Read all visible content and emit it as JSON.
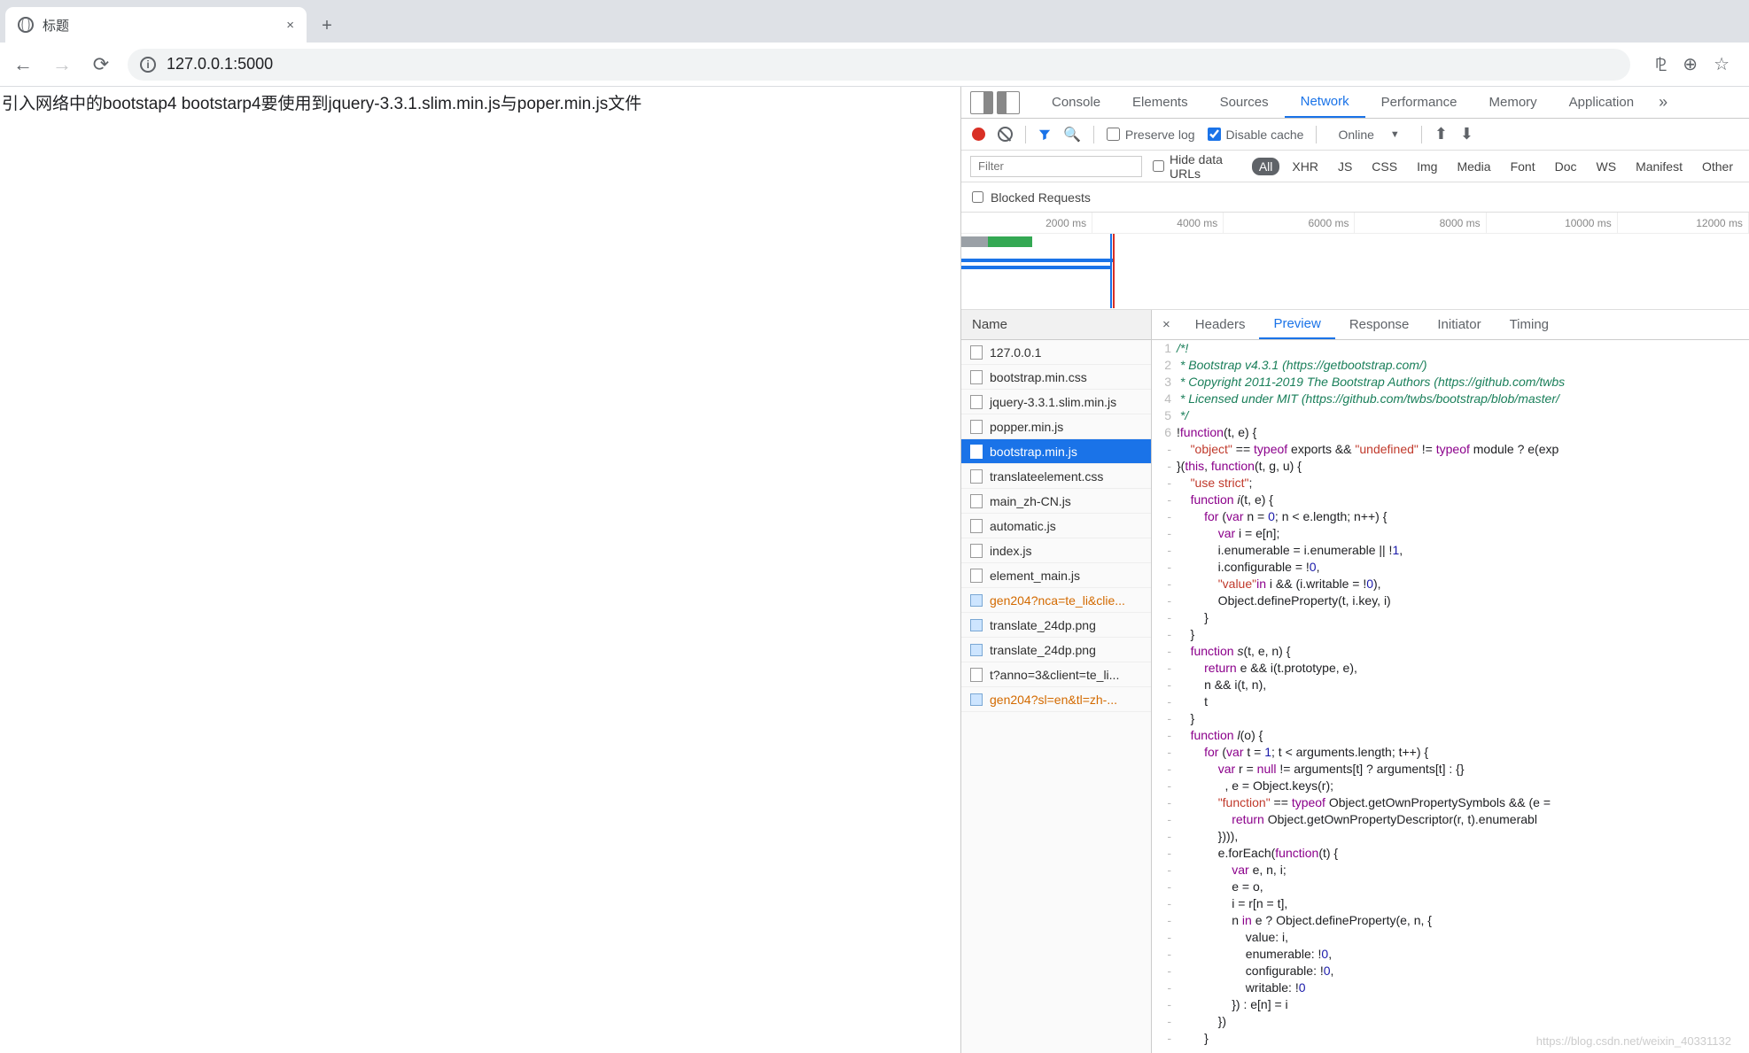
{
  "browser": {
    "tab_title": "标题",
    "url": "127.0.0.1:5000",
    "close_glyph": "×",
    "new_tab_glyph": "+"
  },
  "page": {
    "body_text": "引入网络中的bootstap4 bootstarp4要使用到jquery-3.3.1.slim.min.js与poper.min.js文件"
  },
  "devtools": {
    "tabs": [
      "Console",
      "Elements",
      "Sources",
      "Network",
      "Performance",
      "Memory",
      "Application"
    ],
    "active_tab": "Network",
    "more_glyph": "»",
    "toolbar": {
      "preserve_log_label": "Preserve log",
      "disable_cache_label": "Disable cache",
      "disable_cache_checked": true,
      "throttling_value": "Online",
      "throttling_caret": "▼",
      "upload_glyph": "⬆",
      "download_glyph": "⬇"
    },
    "filterbar": {
      "placeholder": "Filter",
      "hide_data_urls_label": "Hide data URLs",
      "types": [
        "All",
        "XHR",
        "JS",
        "CSS",
        "Img",
        "Media",
        "Font",
        "Doc",
        "WS",
        "Manifest",
        "Other"
      ],
      "active_type": "All",
      "blocked_label": "Blocked Requests"
    },
    "timeline_ticks": [
      "2000 ms",
      "4000 ms",
      "6000 ms",
      "8000 ms",
      "10000 ms",
      "12000 ms"
    ],
    "name_header": "Name",
    "requests": [
      {
        "name": "127.0.0.1",
        "type": "doc"
      },
      {
        "name": "bootstrap.min.css",
        "type": "file"
      },
      {
        "name": "jquery-3.3.1.slim.min.js",
        "type": "file"
      },
      {
        "name": "popper.min.js",
        "type": "file"
      },
      {
        "name": "bootstrap.min.js",
        "type": "file",
        "selected": true
      },
      {
        "name": "translateelement.css",
        "type": "file"
      },
      {
        "name": "main_zh-CN.js",
        "type": "file"
      },
      {
        "name": "automatic.js",
        "type": "file"
      },
      {
        "name": "index.js",
        "type": "file"
      },
      {
        "name": "element_main.js",
        "type": "file"
      },
      {
        "name": "gen204?nca=te_li&clie...",
        "type": "img",
        "orange": true
      },
      {
        "name": "translate_24dp.png",
        "type": "img"
      },
      {
        "name": "translate_24dp.png",
        "type": "img"
      },
      {
        "name": "t?anno=3&client=te_li...",
        "type": "file"
      },
      {
        "name": "gen204?sl=en&tl=zh-...",
        "type": "img",
        "orange": true
      }
    ],
    "detail_tabs": [
      "Headers",
      "Preview",
      "Response",
      "Initiator",
      "Timing"
    ],
    "active_detail_tab": "Preview",
    "code": [
      {
        "n": "1",
        "body": [
          {
            "t": "/*!",
            "c": "cm"
          }
        ]
      },
      {
        "n": "2",
        "body": [
          {
            "t": " * Bootstrap v4.3.1 (https://getbootstrap.com/)",
            "c": "cm"
          }
        ]
      },
      {
        "n": "3",
        "body": [
          {
            "t": " * Copyright 2011-2019 The Bootstrap Authors (https://github.com/twbs",
            "c": "cm"
          }
        ]
      },
      {
        "n": "4",
        "body": [
          {
            "t": " * Licensed under MIT (https://github.com/twbs/bootstrap/blob/master/",
            "c": "cm"
          }
        ]
      },
      {
        "n": "5",
        "body": [
          {
            "t": " */",
            "c": "cm"
          }
        ]
      },
      {
        "n": "6",
        "body": [
          {
            "t": "!"
          },
          {
            "t": "function",
            "c": "kw"
          },
          {
            "t": "(t, e) {"
          }
        ]
      },
      {
        "n": "-",
        "body": [
          {
            "t": "    "
          },
          {
            "t": "\"object\"",
            "c": "str"
          },
          {
            "t": " == "
          },
          {
            "t": "typeof",
            "c": "kw"
          },
          {
            "t": " exports && "
          },
          {
            "t": "\"undefined\"",
            "c": "str"
          },
          {
            "t": " != "
          },
          {
            "t": "typeof",
            "c": "kw"
          },
          {
            "t": " module ? e(exp"
          }
        ]
      },
      {
        "n": "-",
        "body": [
          {
            "t": "}("
          },
          {
            "t": "this",
            "c": "kw"
          },
          {
            "t": ", "
          },
          {
            "t": "function",
            "c": "kw"
          },
          {
            "t": "(t, g, u) {"
          }
        ]
      },
      {
        "n": "-",
        "body": [
          {
            "t": "    "
          },
          {
            "t": "\"use strict\"",
            "c": "str"
          },
          {
            "t": ";"
          }
        ]
      },
      {
        "n": "-",
        "body": [
          {
            "t": "    "
          },
          {
            "t": "function",
            "c": "kw"
          },
          {
            "t": " "
          },
          {
            "t": "i",
            "c": "fn"
          },
          {
            "t": "(t, e) {"
          }
        ]
      },
      {
        "n": "-",
        "body": [
          {
            "t": "        "
          },
          {
            "t": "for",
            "c": "kw"
          },
          {
            "t": " ("
          },
          {
            "t": "var",
            "c": "kw"
          },
          {
            "t": " n = "
          },
          {
            "t": "0",
            "c": "num"
          },
          {
            "t": "; n < e.length; n++) {"
          }
        ]
      },
      {
        "n": "-",
        "body": [
          {
            "t": "            "
          },
          {
            "t": "var",
            "c": "kw"
          },
          {
            "t": " i = e[n];"
          }
        ]
      },
      {
        "n": "-",
        "body": [
          {
            "t": "            i.enumerable = i.enumerable || !"
          },
          {
            "t": "1",
            "c": "num"
          },
          {
            "t": ","
          }
        ]
      },
      {
        "n": "-",
        "body": [
          {
            "t": "            i.configurable = !"
          },
          {
            "t": "0",
            "c": "num"
          },
          {
            "t": ","
          }
        ]
      },
      {
        "n": "-",
        "body": [
          {
            "t": "            "
          },
          {
            "t": "\"value\"",
            "c": "str"
          },
          {
            "t": "in",
            "c": "kw"
          },
          {
            "t": " i && (i.writable = !"
          },
          {
            "t": "0",
            "c": "num"
          },
          {
            "t": "),"
          }
        ]
      },
      {
        "n": "-",
        "body": [
          {
            "t": "            Object.defineProperty(t, i.key, i)"
          }
        ]
      },
      {
        "n": "-",
        "body": [
          {
            "t": "        }"
          }
        ]
      },
      {
        "n": "-",
        "body": [
          {
            "t": "    }"
          }
        ]
      },
      {
        "n": "-",
        "body": [
          {
            "t": "    "
          },
          {
            "t": "function",
            "c": "kw"
          },
          {
            "t": " "
          },
          {
            "t": "s",
            "c": "fn"
          },
          {
            "t": "(t, e, n) {"
          }
        ]
      },
      {
        "n": "-",
        "body": [
          {
            "t": "        "
          },
          {
            "t": "return",
            "c": "kw"
          },
          {
            "t": " e && i(t.prototype, e),"
          }
        ]
      },
      {
        "n": "-",
        "body": [
          {
            "t": "        n && i(t, n),"
          }
        ]
      },
      {
        "n": "-",
        "body": [
          {
            "t": "        t"
          }
        ]
      },
      {
        "n": "-",
        "body": [
          {
            "t": "    }"
          }
        ]
      },
      {
        "n": "-",
        "body": [
          {
            "t": "    "
          },
          {
            "t": "function",
            "c": "kw"
          },
          {
            "t": " "
          },
          {
            "t": "l",
            "c": "fn"
          },
          {
            "t": "(o) {"
          }
        ]
      },
      {
        "n": "-",
        "body": [
          {
            "t": "        "
          },
          {
            "t": "for",
            "c": "kw"
          },
          {
            "t": " ("
          },
          {
            "t": "var",
            "c": "kw"
          },
          {
            "t": " t = "
          },
          {
            "t": "1",
            "c": "num"
          },
          {
            "t": "; t < arguments.length; t++) {"
          }
        ]
      },
      {
        "n": "-",
        "body": [
          {
            "t": "            "
          },
          {
            "t": "var",
            "c": "kw"
          },
          {
            "t": " r = "
          },
          {
            "t": "null",
            "c": "kw"
          },
          {
            "t": " != arguments[t] ? arguments[t] : {}"
          }
        ]
      },
      {
        "n": "-",
        "body": [
          {
            "t": "              , e = Object.keys(r);"
          }
        ]
      },
      {
        "n": "-",
        "body": [
          {
            "t": "            "
          },
          {
            "t": "\"function\"",
            "c": "str"
          },
          {
            "t": " == "
          },
          {
            "t": "typeof",
            "c": "kw"
          },
          {
            "t": " Object.getOwnPropertySymbols && (e ="
          }
        ]
      },
      {
        "n": "-",
        "body": [
          {
            "t": "                "
          },
          {
            "t": "return",
            "c": "kw"
          },
          {
            "t": " Object.getOwnPropertyDescriptor(r, t).enumerabl"
          }
        ]
      },
      {
        "n": "-",
        "body": [
          {
            "t": "            }))),"
          }
        ]
      },
      {
        "n": "-",
        "body": [
          {
            "t": "            e.forEach("
          },
          {
            "t": "function",
            "c": "kw"
          },
          {
            "t": "(t) {"
          }
        ]
      },
      {
        "n": "-",
        "body": [
          {
            "t": "                "
          },
          {
            "t": "var",
            "c": "kw"
          },
          {
            "t": " e, n, i;"
          }
        ]
      },
      {
        "n": "-",
        "body": [
          {
            "t": "                e = o,"
          }
        ]
      },
      {
        "n": "-",
        "body": [
          {
            "t": "                i = r[n = t],"
          }
        ]
      },
      {
        "n": "-",
        "body": [
          {
            "t": "                n "
          },
          {
            "t": "in",
            "c": "kw"
          },
          {
            "t": " e ? Object.defineProperty(e, n, {"
          }
        ]
      },
      {
        "n": "-",
        "body": [
          {
            "t": "                    value: i,"
          }
        ]
      },
      {
        "n": "-",
        "body": [
          {
            "t": "                    enumerable: !"
          },
          {
            "t": "0",
            "c": "num"
          },
          {
            "t": ","
          }
        ]
      },
      {
        "n": "-",
        "body": [
          {
            "t": "                    configurable: !"
          },
          {
            "t": "0",
            "c": "num"
          },
          {
            "t": ","
          }
        ]
      },
      {
        "n": "-",
        "body": [
          {
            "t": "                    writable: !"
          },
          {
            "t": "0",
            "c": "num"
          }
        ]
      },
      {
        "n": "-",
        "body": [
          {
            "t": "                }) : e[n] = i"
          }
        ]
      },
      {
        "n": "-",
        "body": [
          {
            "t": "            })"
          }
        ]
      },
      {
        "n": "-",
        "body": [
          {
            "t": "        }"
          }
        ]
      }
    ]
  },
  "watermark": "https://blog.csdn.net/weixin_40331132"
}
